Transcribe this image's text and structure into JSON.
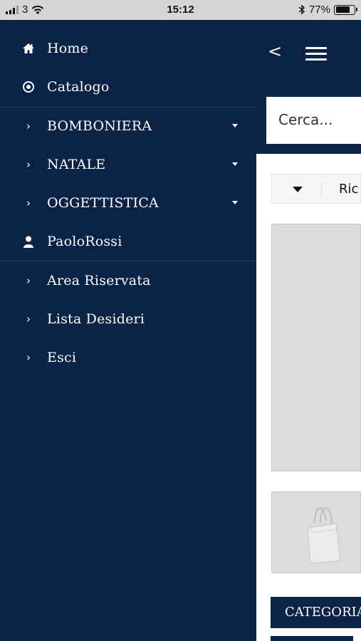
{
  "status_bar": {
    "carrier": "3",
    "time": "15:12",
    "battery": "77%",
    "battery_level": 0.77
  },
  "drawer": {
    "items": [
      {
        "label": "Home",
        "icon": "home-icon"
      },
      {
        "label": "Catalogo",
        "icon": "target-icon"
      },
      {
        "label": "BOMBONIERA",
        "icon": "chevron-right-icon",
        "has_submenu": true
      },
      {
        "label": "NATALE",
        "icon": "chevron-right-icon",
        "has_submenu": true
      },
      {
        "label": "OGGETTISTICA",
        "icon": "chevron-right-icon",
        "has_submenu": true
      },
      {
        "label": "PaoloRossi",
        "icon": "user-icon"
      },
      {
        "label": "Area Riservata",
        "icon": "chevron-right-icon"
      },
      {
        "label": "Lista Desideri",
        "icon": "chevron-right-icon"
      },
      {
        "label": "Esci",
        "icon": "chevron-right-icon"
      }
    ]
  },
  "header": {
    "back": "<"
  },
  "search": {
    "placeholder": "Cerca..."
  },
  "filter": {
    "label": "Ric"
  },
  "categories": {
    "label": "CATEGORIA"
  },
  "colors": {
    "navy": "#0a2346",
    "divider": "#2b4266",
    "status_bar": "#d6d6d6"
  }
}
